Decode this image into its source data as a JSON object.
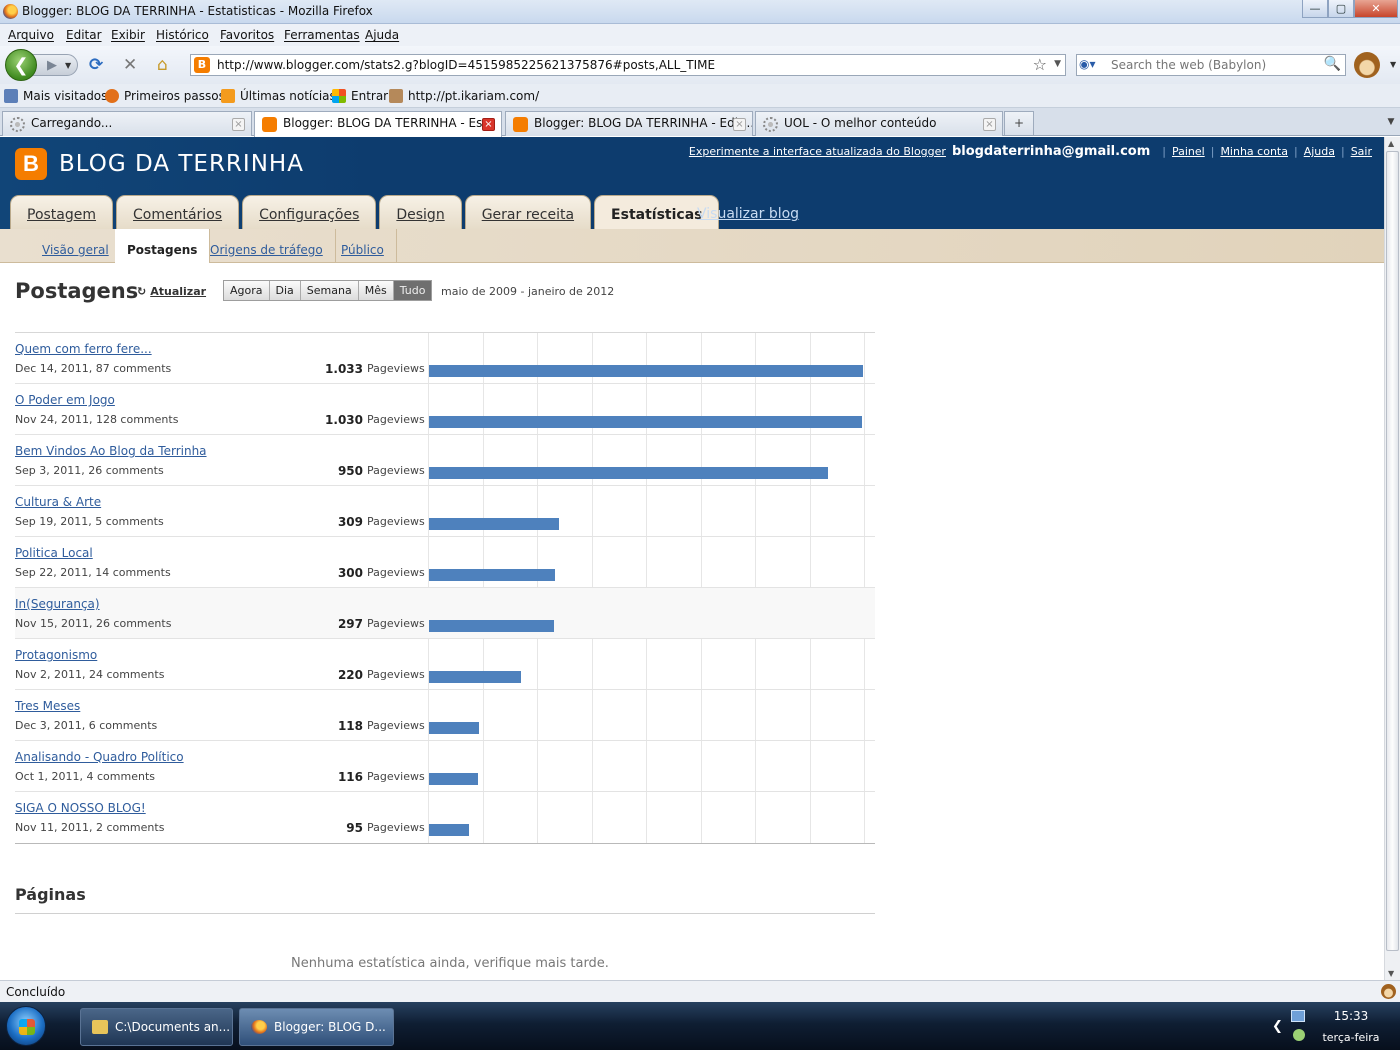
{
  "window": {
    "title": "Blogger: BLOG DA TERRINHA - Estatisticas - Mozilla Firefox"
  },
  "menu": [
    "Arquivo",
    "Editar",
    "Exibir",
    "Histórico",
    "Favoritos",
    "Ferramentas",
    "Ajuda"
  ],
  "nav": {
    "url": "http://www.blogger.com/stats2.g?blogID=4515985225621375876#posts,ALL_TIME",
    "search_placeholder": "Search the web (Babylon)"
  },
  "bookmarks": [
    "Mais visitados",
    "Primeiros passos",
    "Últimas notícias",
    "Entrar",
    "http://pt.ikariam.com/"
  ],
  "tabs": [
    {
      "label": "Carregando..."
    },
    {
      "label": "Blogger: BLOG DA TERRINHA - Es..."
    },
    {
      "label": "Blogger: BLOG DA TERRINHA - Edit..."
    },
    {
      "label": "UOL - O melhor conteúdo"
    }
  ],
  "blog": {
    "name": "BLOG DA TERRINHA",
    "links": {
      "try_new": "Experimente a interface atualizada do Blogger",
      "email": "blogdaterrinha@gmail.com",
      "painel": "Painel",
      "conta": "Minha conta",
      "ajuda": "Ajuda",
      "sair": "Sair"
    },
    "main_tabs": [
      "Postagem",
      "Comentários",
      "Configurações",
      "Design",
      "Gerar receita",
      "Estatísticas"
    ],
    "view_blog": "Visualizar blog",
    "sub_tabs": [
      "Visão geral",
      "Postagens",
      "Origens de tráfego",
      "Público"
    ]
  },
  "stats": {
    "title": "Postagens",
    "refresh": "Atualizar",
    "ranges": [
      "Agora",
      "Dia",
      "Semana",
      "Mês",
      "Tudo"
    ],
    "active_range": "Tudo",
    "date_range": "maio de 2009 - janeiro de 2012",
    "pageviews_label": "Pageviews",
    "posts": [
      {
        "title": "Quem com ferro fere...",
        "meta": "Dec 14, 2011, 87 comments",
        "count_label": "1.033",
        "views": 1033
      },
      {
        "title": "O Poder em Jogo",
        "meta": "Nov 24, 2011, 128 comments",
        "count_label": "1.030",
        "views": 1030
      },
      {
        "title": "Bem Vindos Ao Blog da Terrinha",
        "meta": "Sep 3, 2011, 26 comments",
        "count_label": "950",
        "views": 950
      },
      {
        "title": "Cultura & Arte",
        "meta": "Sep 19, 2011, 5 comments",
        "count_label": "309",
        "views": 309
      },
      {
        "title": "Politica Local",
        "meta": "Sep 22, 2011, 14 comments",
        "count_label": "300",
        "views": 300
      },
      {
        "title": "In(Segurança)",
        "meta": "Nov 15, 2011, 26 comments",
        "count_label": "297",
        "views": 297
      },
      {
        "title": "Protagonismo",
        "meta": "Nov 2, 2011, 24 comments",
        "count_label": "220",
        "views": 220
      },
      {
        "title": "Tres Meses",
        "meta": "Dec 3, 2011, 6 comments",
        "count_label": "118",
        "views": 118
      },
      {
        "title": "Analisando - Quadro Político",
        "meta": "Oct 1, 2011, 4 comments",
        "count_label": "116",
        "views": 116
      },
      {
        "title": "SIGA O NOSSO BLOG!",
        "meta": "Nov 11, 2011, 2 comments",
        "count_label": "95",
        "views": 95
      }
    ],
    "max_views": 1040,
    "pages_heading": "Páginas",
    "no_stats": "Nenhuma estatística ainda, verifique mais tarde."
  },
  "status": {
    "text": "Concluído"
  },
  "taskbar": {
    "buttons": [
      "C:\\Documents an...",
      "Blogger: BLOG D..."
    ],
    "time": "15:33",
    "day": "terça-feira"
  },
  "colors": {
    "blogger_header": "#0d3c6e",
    "bar": "#4e81bd",
    "link": "#2f5c9c",
    "blogger_orange": "#f57d00"
  }
}
